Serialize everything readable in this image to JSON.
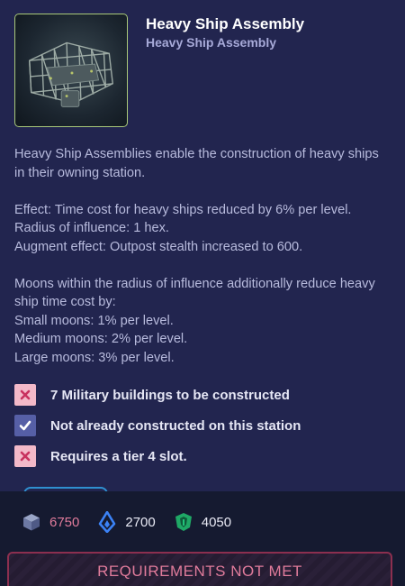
{
  "header": {
    "title": "Heavy Ship Assembly",
    "subtitle": "Heavy Ship Assembly",
    "image_icon": "ship-frame-structure-image"
  },
  "description": {
    "paragraphs": [
      "Heavy Ship Assemblies enable the construction of heavy ships in their owning station.",
      "Effect: Time cost for heavy ships reduced by 6% per level.",
      "Radius of influence: 1 hex.",
      "Augment effect: Outpost stealth increased to 600.",
      "Moons within the radius of influence additionally reduce heavy ship time cost by:",
      "Small moons: 1% per level.",
      "Medium moons: 2% per level.",
      "Large moons: 3% per level."
    ]
  },
  "requirements": [
    {
      "text": "7 Military buildings to be constructed",
      "met": false,
      "icon": "cross-icon"
    },
    {
      "text": "Not already constructed on this station",
      "met": true,
      "icon": "check-icon"
    },
    {
      "text": "Requires a tier 4 slot.",
      "met": false,
      "icon": "cross-icon"
    }
  ],
  "costs": [
    {
      "resource": "metal",
      "icon": "cube-icon",
      "value": "6750",
      "color": "#e07b9b",
      "insufficient": true
    },
    {
      "resource": "gas",
      "icon": "flame-icon",
      "value": "2700",
      "color": "#3b82f6",
      "insufficient": false
    },
    {
      "resource": "crystal",
      "icon": "gem-icon",
      "value": "4050",
      "color": "#22c37a",
      "insufficient": false
    }
  ],
  "status_button": {
    "label": "REQUIREMENTS NOT MET"
  },
  "colors": {
    "background": "#22254f",
    "footer": "#151a30",
    "fail": "#f3b9c9",
    "ok": "#565fa6",
    "warning_text": "#e07b9b",
    "thumb_border": "#a9c97a"
  }
}
